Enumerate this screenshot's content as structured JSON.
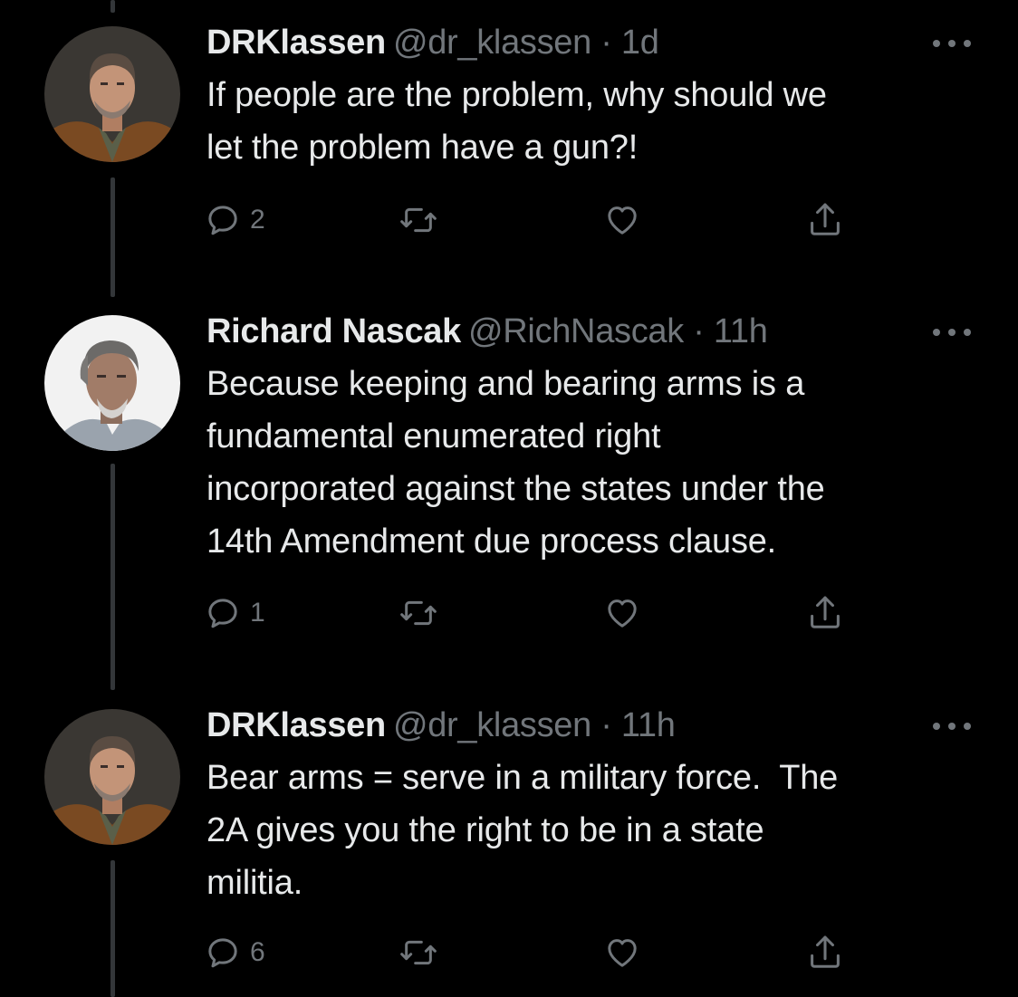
{
  "thread": [
    {
      "display_name": "DRKlassen",
      "handle": "@dr_klassen",
      "separator": "·",
      "time": "1d",
      "text_lines": [
        "If people are the problem, why should we",
        "let the problem have a gun?!"
      ],
      "reply_count": "2",
      "avatar": "avatar-dr-klassen"
    },
    {
      "display_name": "Richard Nascak",
      "handle": "@RichNascak",
      "separator": "·",
      "time": "11h",
      "text_lines": [
        "Because keeping and bearing arms is a",
        "fundamental enumerated right",
        "incorporated against the states under the",
        "14th Amendment due process clause."
      ],
      "reply_count": "1",
      "avatar": "avatar-richard-nascak"
    },
    {
      "display_name": "DRKlassen",
      "handle": "@dr_klassen",
      "separator": "·",
      "time": "11h",
      "text_lines": [
        "Bear arms = serve in a military force.  The",
        "2A gives you the right to be in a state",
        "militia."
      ],
      "reply_count": "6",
      "avatar": "avatar-dr-klassen"
    }
  ],
  "icons": {
    "reply": "reply-icon",
    "retweet": "retweet-icon",
    "like": "heart-icon",
    "share": "share-icon",
    "more": "more-options-icon"
  },
  "colors": {
    "background": "#000000",
    "primary_text": "#e7e9ea",
    "secondary_text": "#71767b",
    "thread_line": "#333639"
  }
}
